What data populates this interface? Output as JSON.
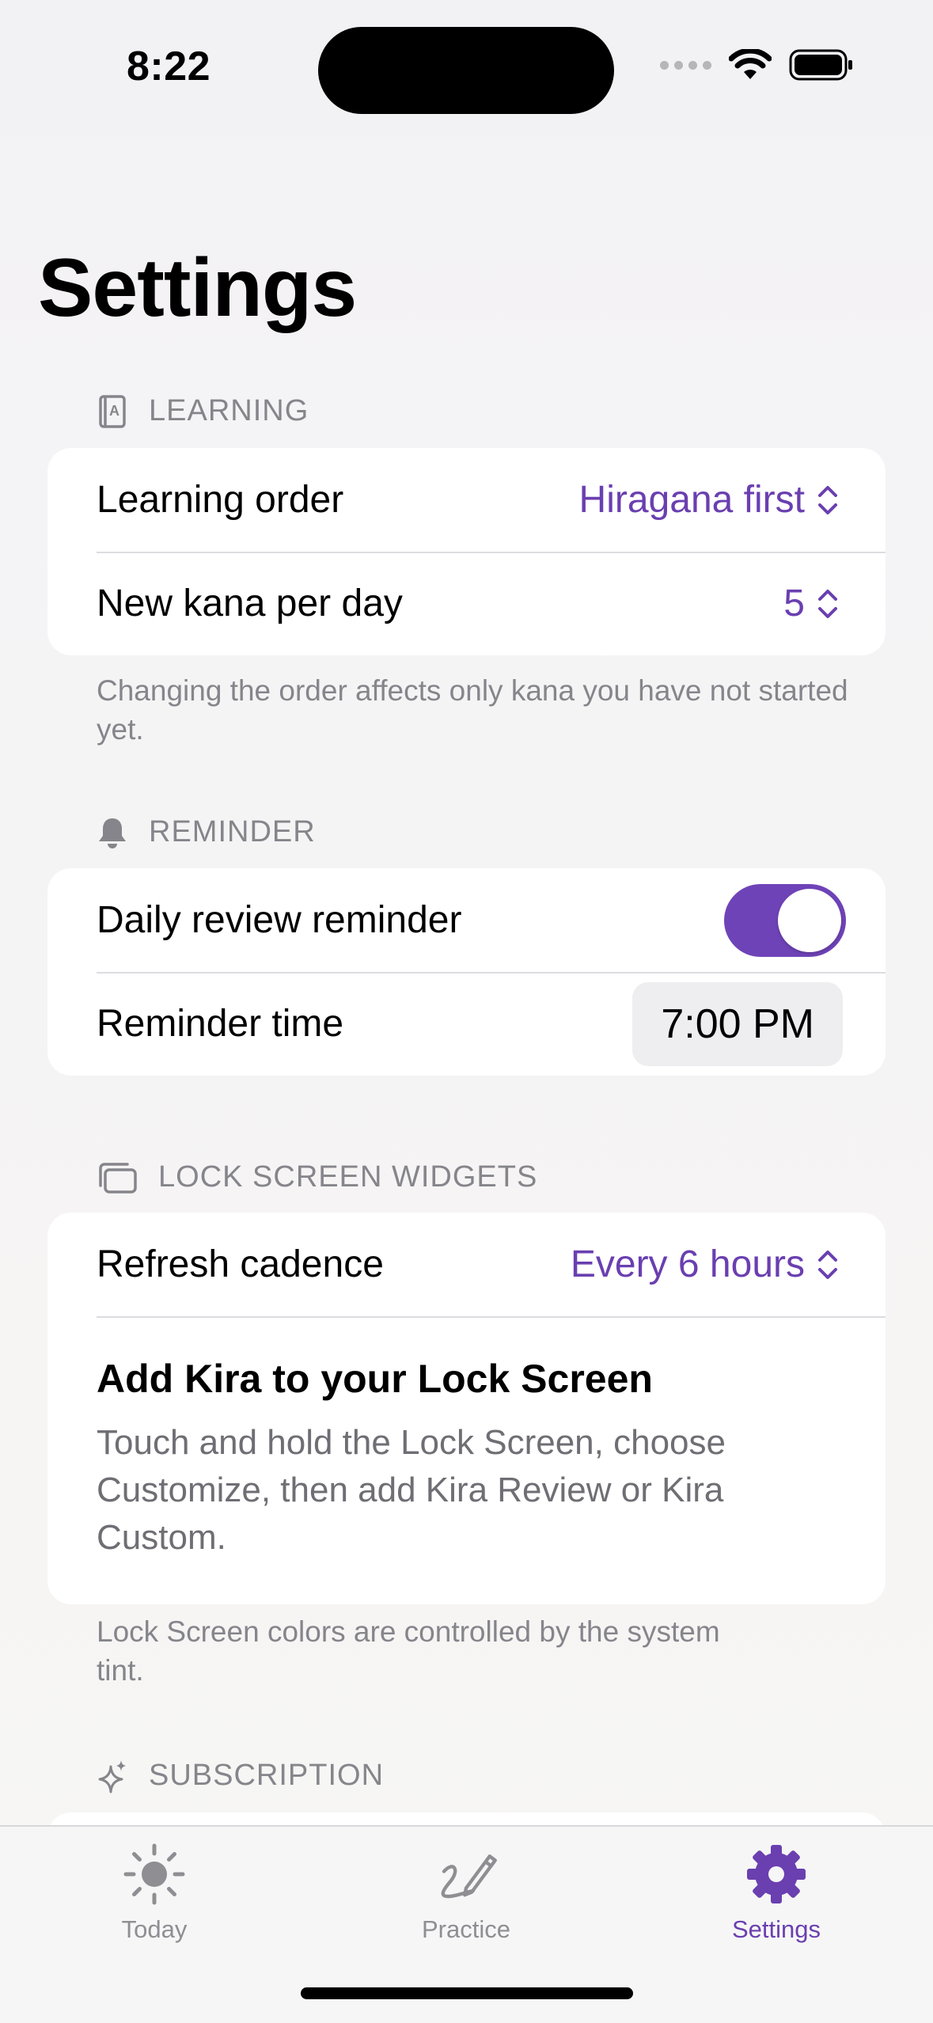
{
  "status_bar": {
    "time": "8:22"
  },
  "page": {
    "title": "Settings"
  },
  "learning": {
    "header": "LEARNING",
    "icon": "book-icon",
    "rows": [
      {
        "label": "Learning order",
        "value": "Hiragana first"
      },
      {
        "label": "New kana per day",
        "value": "5"
      }
    ],
    "footer": "Changing the order affects only kana you have not started yet."
  },
  "reminder": {
    "header": "REMINDER",
    "icon": "bell-icon",
    "toggle_label": "Daily review reminder",
    "toggle_on": true,
    "time_label": "Reminder time",
    "time_value": "7:00 PM"
  },
  "widgets": {
    "header": "LOCK SCREEN WIDGETS",
    "icon": "widgets-icon",
    "cadence_label": "Refresh cadence",
    "cadence_value": "Every 6 hours",
    "info_title": "Add Kira to your Lock Screen",
    "info_desc": "Touch and hold the Lock Screen, choose Customize, then add Kira Review or Kira Custom.",
    "footer": "Lock Screen colors are controlled by the system tint."
  },
  "subscription": {
    "header": "SUBSCRIPTION",
    "icon": "sparkles-icon"
  },
  "tab_bar": {
    "tabs": [
      {
        "label": "Today",
        "icon": "sun-icon",
        "selected": false
      },
      {
        "label": "Practice",
        "icon": "pencil-scribble-icon",
        "selected": false
      },
      {
        "label": "Settings",
        "icon": "gear-icon",
        "selected": true
      }
    ]
  },
  "colors": {
    "accent": "#6a3fb0",
    "secondary_text": "#85858b",
    "tab_inactive": "#8e8e93"
  }
}
